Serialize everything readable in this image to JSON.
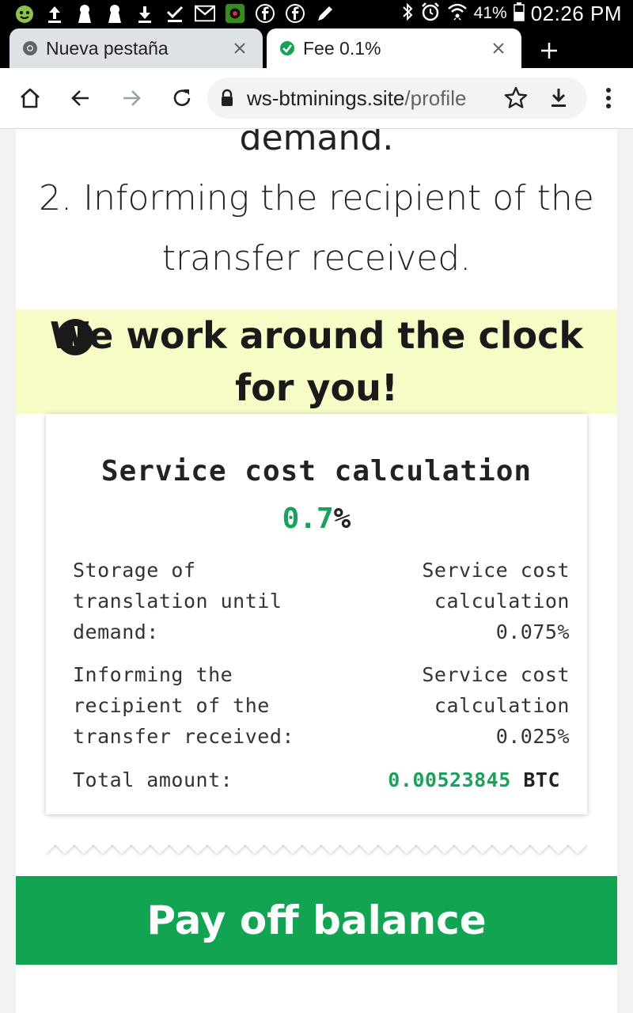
{
  "status_bar": {
    "battery_percent": "41%",
    "time": "02:26 PM",
    "left_icons": [
      "android-icon",
      "upload-icon",
      "keyhole-icon",
      "keyhole-icon",
      "download-icon",
      "download-done-icon",
      "gmail-icon",
      "app-icon",
      "facebook-icon",
      "facebook-icon",
      "pen-icon"
    ],
    "right_icons": [
      "bluetooth-icon",
      "alarm-icon",
      "wifi-icon",
      "battery-icon"
    ]
  },
  "tabs": [
    {
      "title": "Nueva pestaña",
      "favicon": "chrome-icon",
      "active": false
    },
    {
      "title": "Fee 0.1%",
      "favicon": "check-circle-icon",
      "active": true
    }
  ],
  "toolbar": {
    "url_host": "ws-btminings.site",
    "url_path": "/profile"
  },
  "page": {
    "partial_line": "demand.",
    "step2": "2. Informing the recipient of the transfer received.",
    "banner": "We work around the clock for you!",
    "receipt": {
      "title": "Service cost calculation",
      "percent_value": "0.7",
      "percent_sign": "%",
      "rows": [
        {
          "label": "Storage of translation until demand:",
          "value": "Service cost calculation 0.075%"
        },
        {
          "label": "Informing the recipient of the transfer received:",
          "value": "Service cost calculation 0.025%"
        }
      ],
      "total_label": "Total amount:",
      "total_value": "0.00523845",
      "total_currency": "BTC"
    },
    "pay_button": "Pay off balance"
  },
  "colors": {
    "accent_green": "#12a353",
    "banner_bg": "#f7fbc6",
    "text_dark": "#222222"
  }
}
